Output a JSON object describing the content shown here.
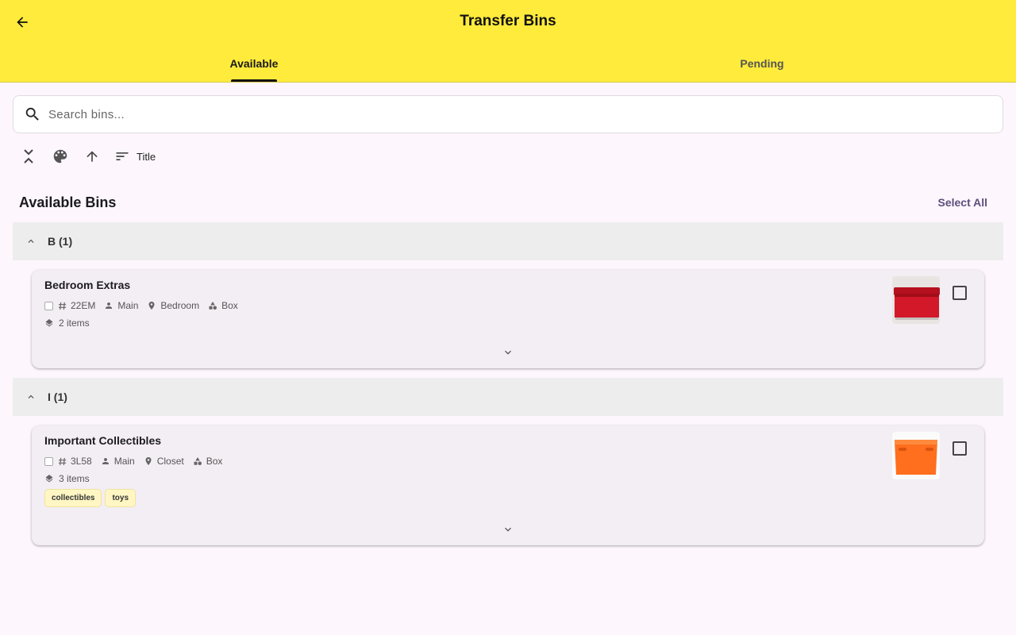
{
  "appbar": {
    "title": "Transfer Bins",
    "tabs": [
      {
        "label": "Available",
        "active": true
      },
      {
        "label": "Pending",
        "active": false
      }
    ],
    "color": "#ffeb3b"
  },
  "search": {
    "placeholder": "Search bins...",
    "value": ""
  },
  "toolbar": {
    "icons": [
      "collapse-all-icon",
      "palette-icon",
      "arrow-up-icon",
      "sort-icon"
    ],
    "sort_label": "Title"
  },
  "section": {
    "title": "Available Bins",
    "select_all_label": "Select All"
  },
  "groups": [
    {
      "label": "B (1)",
      "expanded": true,
      "bins": [
        {
          "title": "Bedroom Extras",
          "code": "22EM",
          "owner": "Main",
          "location": "Bedroom",
          "type": "Box",
          "items": "2 items",
          "tags": [],
          "thumb_color": "#d3182a",
          "checked": false
        }
      ]
    },
    {
      "label": "I (1)",
      "expanded": true,
      "bins": [
        {
          "title": "Important Collectibles",
          "code": "3L58",
          "owner": "Main",
          "location": "Closet",
          "type": "Box",
          "items": "3 items",
          "tags": [
            "collectibles",
            "toys"
          ],
          "thumb_color": "#ff6f1e",
          "checked": false
        }
      ]
    }
  ]
}
